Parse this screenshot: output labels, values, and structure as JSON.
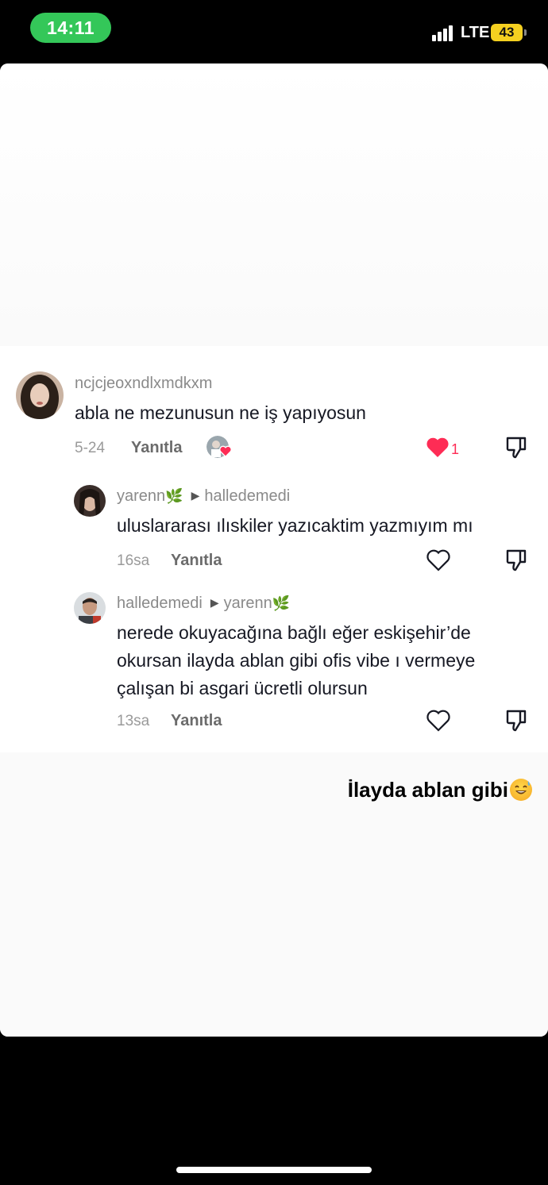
{
  "status_bar": {
    "time": "14:11",
    "network": "LTE",
    "battery": "43",
    "accent": "#34c759",
    "battery_color": "#f5d020"
  },
  "comments": [
    {
      "username": "ncjcjeoxndlxmdkxm",
      "text": "abla ne mezunusun ne iş yapıyosun",
      "date": "5-24",
      "reply_label": "Yanıtla",
      "like_count": "1",
      "liked": true
    },
    {
      "username": "yarenn",
      "reply_to": "halledemedi",
      "text": "uluslararası ılıskiler yazıcaktim yazmıyım mı",
      "date": "16sa",
      "reply_label": "Yanıtla"
    },
    {
      "username": "halledemedi",
      "reply_to": "yarenn",
      "text_lines": [
        "nerede okuyacağına bağlı eğer eskişehir’de",
        "okursan ilayda ablan gibi ofis vibe ı vermeye",
        "çalışan bi asgari ücretli olursun"
      ],
      "date": "13sa",
      "reply_label": "Yanıtla"
    }
  ],
  "caption": "İlayda ablan gibi",
  "colors": {
    "like_red": "#fe2c55"
  }
}
